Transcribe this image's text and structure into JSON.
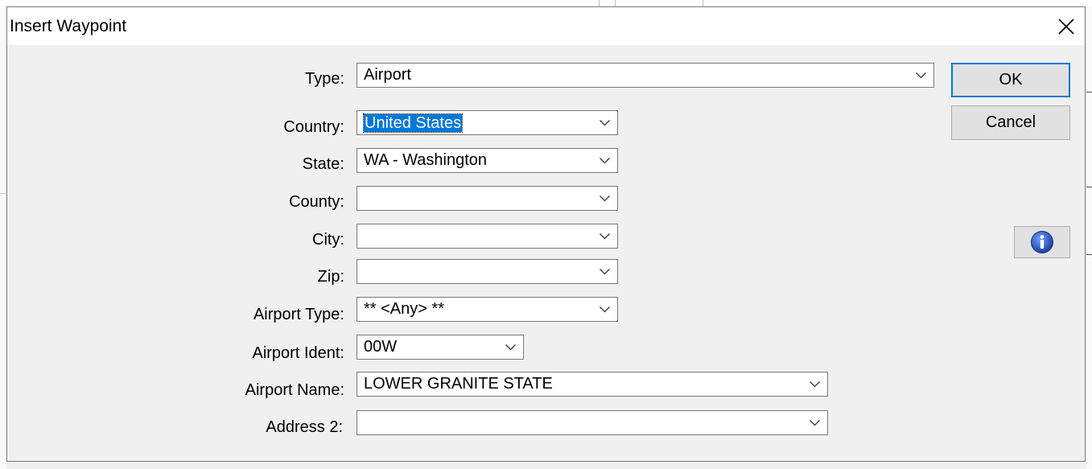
{
  "dialog": {
    "title": "Insert Waypoint",
    "close_glyph": "close-icon"
  },
  "fields": {
    "type": {
      "label": "Type:",
      "value": "Airport"
    },
    "country": {
      "label": "Country:",
      "value": "United States"
    },
    "state": {
      "label": "State:",
      "value": "WA - Washington"
    },
    "county": {
      "label": "County:",
      "value": ""
    },
    "city": {
      "label": "City:",
      "value": ""
    },
    "zip": {
      "label": "Zip:",
      "value": ""
    },
    "airport_type": {
      "label": "Airport Type:",
      "value": "** <Any> **"
    },
    "airport_ident": {
      "label": "Airport Ident:",
      "value": "00W"
    },
    "airport_name": {
      "label": "Airport Name:",
      "value": "LOWER GRANITE STATE"
    },
    "address2": {
      "label": "Address 2:",
      "value": ""
    }
  },
  "buttons": {
    "ok": "OK",
    "cancel": "Cancel",
    "info_icon": "info-icon"
  },
  "colors": {
    "selection": "#0078d7",
    "default_button_border": "#0078d7",
    "info_icon": "#1b54c0"
  }
}
